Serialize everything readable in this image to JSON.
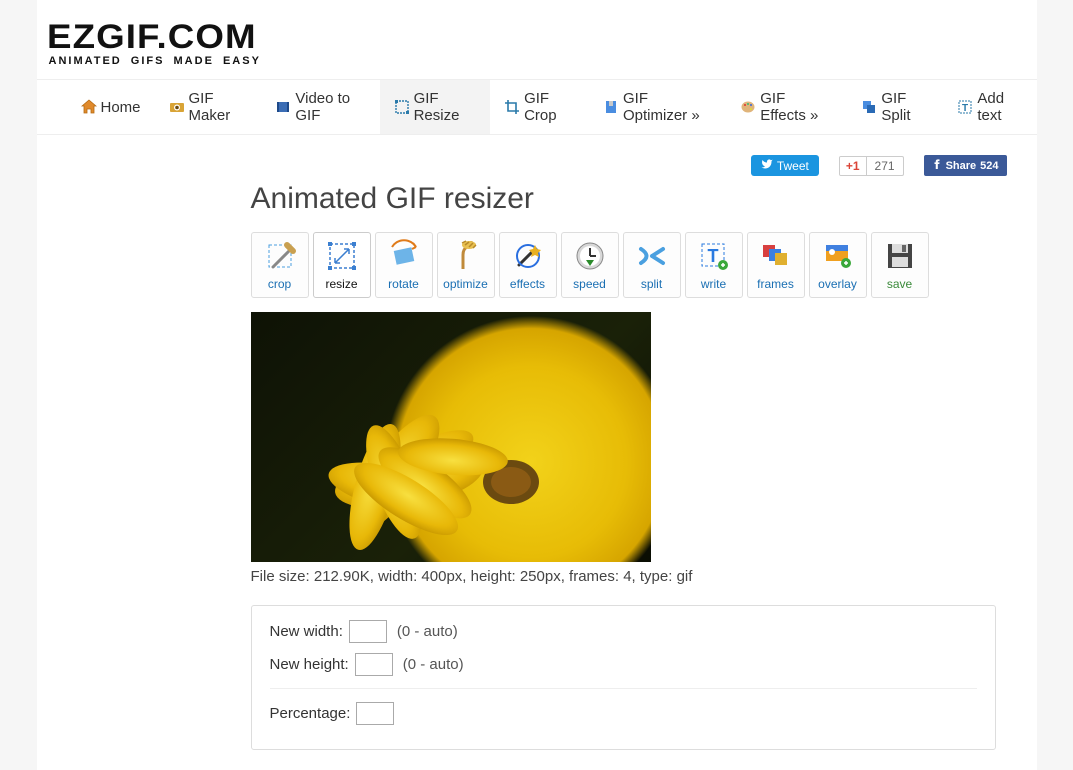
{
  "logo": {
    "main": "EZGIF.COM",
    "tagline": "ANIMATED GIFS MADE EASY"
  },
  "nav": {
    "home": "Home",
    "gif_maker": "GIF Maker",
    "video_to_gif": "Video to GIF",
    "gif_resize": "GIF Resize",
    "gif_crop": "GIF Crop",
    "gif_optimizer": "GIF Optimizer »",
    "gif_effects": "GIF Effects »",
    "gif_split": "GIF Split",
    "add_text": "Add text"
  },
  "share": {
    "tweet": "Tweet",
    "gplus": "+1",
    "gplus_count": "271",
    "fb_share": "Share",
    "fb_count": "524"
  },
  "title": "Animated GIF resizer",
  "tools": {
    "crop": "crop",
    "resize": "resize",
    "rotate": "rotate",
    "optimize": "optimize",
    "effects": "effects",
    "speed": "speed",
    "split": "split",
    "write": "write",
    "frames": "frames",
    "overlay": "overlay",
    "save": "save"
  },
  "fileinfo": "File size: 212.90K, width: 400px, height: 250px, frames: 4, type: gif",
  "form": {
    "new_width_label": "New width:",
    "new_width_value": "",
    "new_height_label": "New height:",
    "new_height_value": "",
    "auto_hint": "(0 - auto)",
    "percentage_label": "Percentage:",
    "percentage_value": ""
  }
}
